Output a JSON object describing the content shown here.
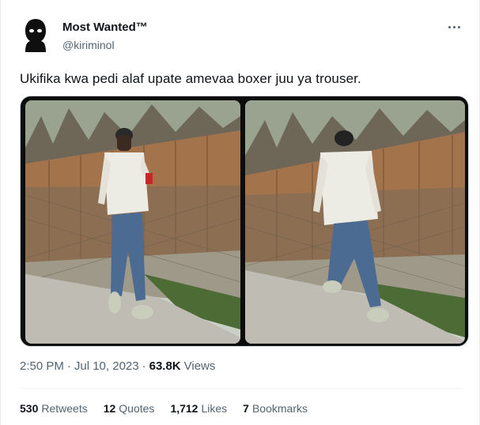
{
  "author": {
    "display_name": "Most Wanted™",
    "handle": "@kiriminol",
    "avatar_icon": "masked-figure-avatar"
  },
  "more_icon": "more-options-icon",
  "tweet": {
    "text": "Ukifika kwa pedi alaf upate amevaa boxer juu ya trouser."
  },
  "media": {
    "count": 2,
    "items": [
      "photo-walking-front",
      "photo-walking-back"
    ]
  },
  "meta": {
    "time": "2:50 PM",
    "sep1": "·",
    "date": "Jul 10, 2023",
    "sep2": "·",
    "views_count": "63.8K",
    "views_label": "Views"
  },
  "stats": [
    {
      "num": "530",
      "label": "Retweets"
    },
    {
      "num": "12",
      "label": "Quotes"
    },
    {
      "num": "1,712",
      "label": "Likes"
    },
    {
      "num": "7",
      "label": "Bookmarks"
    }
  ],
  "colors": {
    "text_primary": "#0f1419",
    "text_secondary": "#536471",
    "divider": "#eff3f4"
  }
}
